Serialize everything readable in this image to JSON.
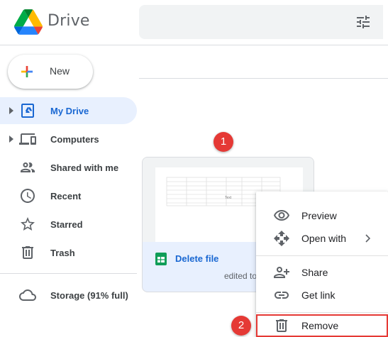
{
  "app": {
    "title": "Drive"
  },
  "new_button": {
    "label": "New"
  },
  "sidebar": {
    "items": [
      {
        "label": "My Drive",
        "icon": "my-drive-icon",
        "active": true
      },
      {
        "label": "Computers",
        "icon": "computers-icon"
      },
      {
        "label": "Shared with me",
        "icon": "shared-icon"
      },
      {
        "label": "Recent",
        "icon": "clock-icon"
      },
      {
        "label": "Starred",
        "icon": "star-icon"
      },
      {
        "label": "Trash",
        "icon": "trash-icon"
      }
    ],
    "storage": {
      "label": "Storage (91% full)",
      "icon": "cloud-icon"
    }
  },
  "file_card": {
    "name": "Delete file",
    "meta": "edited to",
    "type_icon": "google-sheets-icon",
    "thumb_text": "Text"
  },
  "context_menu": {
    "items": [
      {
        "label": "Preview",
        "icon": "eye-icon"
      },
      {
        "label": "Open with",
        "icon": "move-icon"
      },
      {
        "label": "Share",
        "icon": "person-add-icon"
      },
      {
        "label": "Get link",
        "icon": "link-icon"
      },
      {
        "label": "Remove",
        "icon": "trash-icon"
      }
    ]
  },
  "annotations": {
    "step1": "1",
    "step2": "2"
  },
  "colors": {
    "accent": "#1967d2",
    "active_bg": "#e8f0fe",
    "badge": "#e53935",
    "sheets_green": "#0f9d58"
  }
}
